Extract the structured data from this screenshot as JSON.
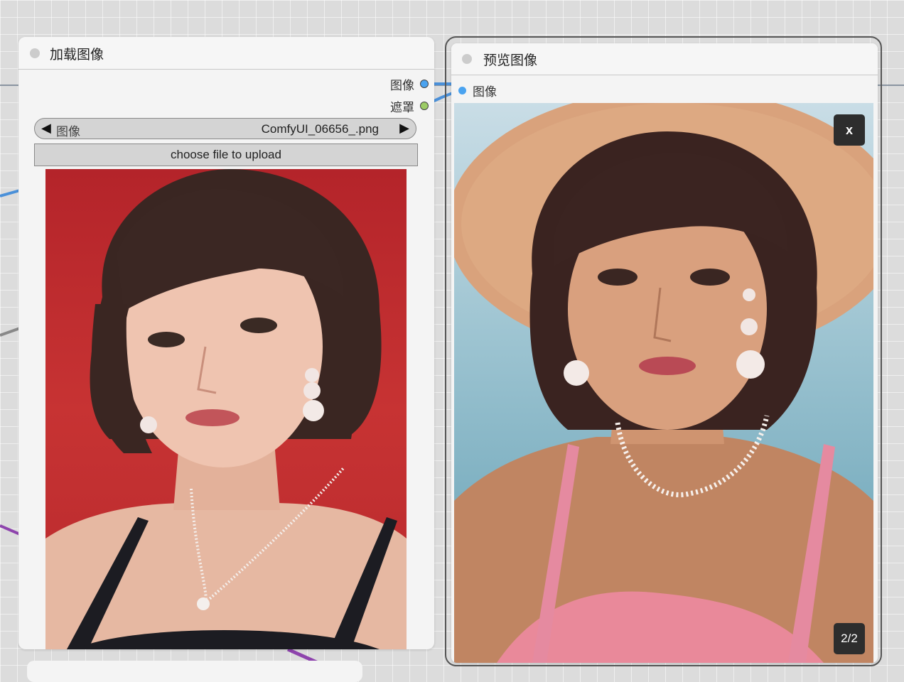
{
  "colors": {
    "link_blue": "#4a90d9",
    "link_mask": "#8ab35a",
    "link_purple": "#8e44ad",
    "slot_image": "#4aa3f0",
    "slot_mask": "#9ccc65",
    "node_bg": "#f4f4f4"
  },
  "load_node": {
    "title": "加载图像",
    "outputs": [
      {
        "label": "图像",
        "color": "#4aa3f0"
      },
      {
        "label": "遮罩",
        "color": "#9ccc65"
      }
    ],
    "combo": {
      "name": "图像",
      "value": "ComfyUI_06656_.png",
      "prev_icon": "◀",
      "next_icon": "▶"
    },
    "upload_label": "choose file to upload"
  },
  "preview_node": {
    "title": "预览图像",
    "input": {
      "label": "图像",
      "color": "#4aa3f0"
    },
    "close_label": "x",
    "counter": "2/2"
  }
}
